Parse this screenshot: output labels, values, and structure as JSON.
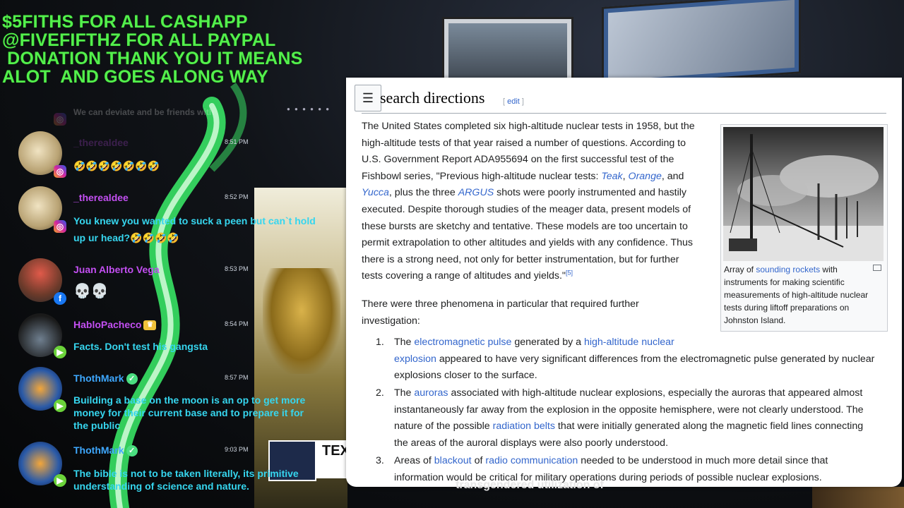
{
  "banner": {
    "line1": "$5FITHS FOR ALL CASHAPP",
    "line2": "@FIVEFIFTHZ FOR ALL PAYPAL",
    "line3": " DONATION THANK YOU IT MEANS",
    "line4": "ALOT  AND GOES ALONG WAY"
  },
  "chat": {
    "faded_top": "We can deviate and be friends with",
    "messages": [
      {
        "user": "_therealdee",
        "time": "8:51 PM",
        "text": "🤣🤣🤣🤣🤣🤣🤣",
        "platform": "instagram"
      },
      {
        "user": "_therealdee",
        "time": "8:52 PM",
        "text_line1": "You knew you wanted to suck a peen but can`t hold",
        "text_line2": "up ur head?🤣🤣🤣🤣",
        "platform": "instagram"
      },
      {
        "user": "Juan Alberto Vega",
        "time": "8:53 PM",
        "text": "💀💀",
        "platform": "facebook"
      },
      {
        "user": "HabloPacheco",
        "time": "8:54 PM",
        "text": "Facts. Don't test his gangsta",
        "platform": "rumble"
      },
      {
        "user": "ThothMark",
        "time": "8:57 PM",
        "text_line1": "Building a base on the moon is an op to get more",
        "text_line2": "money for their current base and to prepare it for",
        "text_line3": "the public",
        "platform": "rumble"
      },
      {
        "user": "ThothMark",
        "time": "9:03 PM",
        "text_line1": "The bible is not to be taken literally, its primitive",
        "text_line2": "understanding of science and nature.",
        "platform": "rumble"
      }
    ]
  },
  "background": {
    "tv_text": "TEX",
    "caption": "transgendered utilization of"
  },
  "wiki": {
    "heading": "search directions",
    "edit_label": "edit",
    "para1": {
      "l1": "The United States completed six high-altitude nuclear tests in 1958, but the",
      "l2": "high-altitude tests of that year raised a number of questions. According to",
      "l3": "U.S. Government Report ADA955694 on the first successful test of the",
      "l4a": "Fishbowl series, \"Previous high-altitude nuclear tests: ",
      "teak": "Teak",
      "orange": "Orange",
      "l4b": ", and",
      "yucca": "Yucca",
      "l5a": ", plus the three ",
      "argus": "ARGUS",
      "l5b": " shots were poorly instrumented and hastily",
      "l6": "executed. Despite thorough studies of the meager data, present models of",
      "l7": "these bursts are sketchy and tentative. These models are too uncertain to",
      "l8": "permit extrapolation to other altitudes and yields with any confidence. Thus",
      "l9": "there is a strong need, not only for better instrumentation, but for further",
      "l10": "tests covering a range of altitudes and yields.\"",
      "ref": "[5]"
    },
    "para2": {
      "l1": "There were three phenomena in particular that required further",
      "l2": "investigation:"
    },
    "figure": {
      "cap_a": "Array of ",
      "cap_link": "sounding rockets",
      "cap_b": " with",
      "cap_l2": "instruments for making scientific",
      "cap_l3": "measurements of high-altitude nuclear",
      "cap_l4": "tests during liftoff preparations on",
      "cap_l5": "Johnston Island."
    },
    "list": [
      {
        "num": "1.",
        "a": "The ",
        "link1": "electromagnetic pulse",
        "b": " generated by a ",
        "link2": "high-altitude nuclear",
        "link2b": "explosion",
        "c": " appeared to have very significant differences from the electromagnetic pulse generated by nuclear",
        "d": "explosions closer to the surface."
      },
      {
        "num": "2.",
        "a": "The ",
        "link1": "auroras",
        "b": " associated with high-altitude nuclear explosions, especially the auroras that appeared almost",
        "c": "instantaneously far away from the explosion in the opposite hemisphere, were not clearly understood. The",
        "d": "nature of the possible ",
        "link2": "radiation belts",
        "e": " that were initially generated along the magnetic field lines connecting",
        "f": "the areas of the auroral displays were also poorly understood."
      },
      {
        "num": "3.",
        "a": "Areas of ",
        "link1": "blackout",
        "b": " of ",
        "link2": "radio communication",
        "c": " needed to be understood in much more detail since that",
        "d": "information would be critical for military operations during periods of possible nuclear explosions."
      }
    ]
  },
  "colors": {
    "banner": "#53f04c",
    "link": "#3366cc",
    "name_purple": "#c34ff2",
    "name_blue": "#3ea8ff"
  }
}
